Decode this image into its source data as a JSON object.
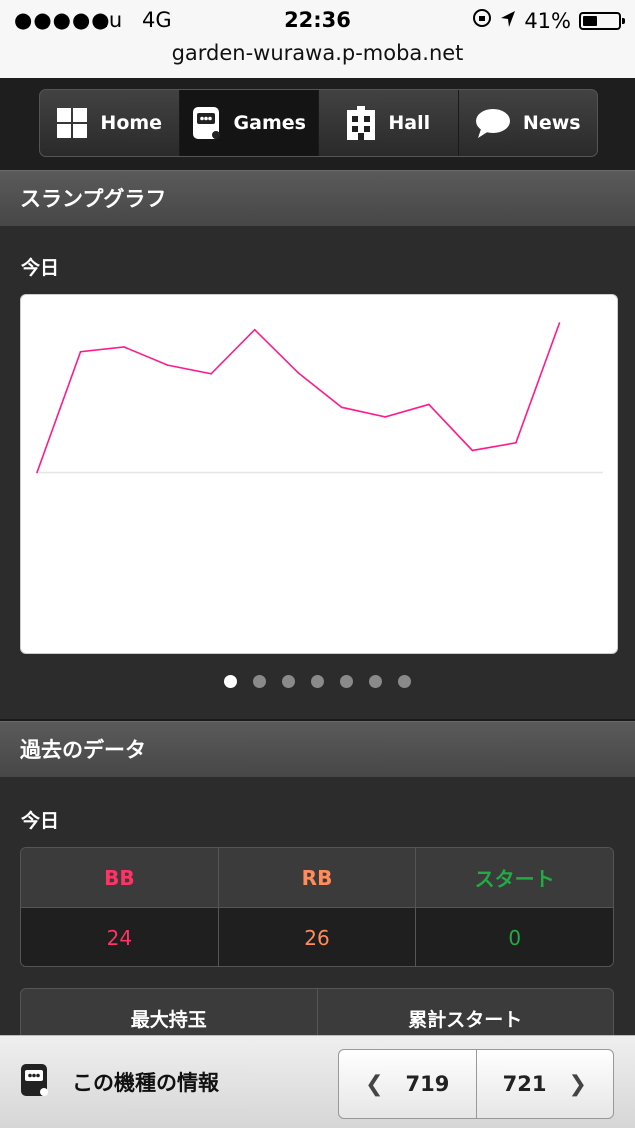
{
  "status_bar": {
    "signal": "●●●●●",
    "carrier": "au",
    "network": "4G",
    "time": "22:36",
    "battery": "41%",
    "battery_level": 0.41
  },
  "url": "garden-wurawa.p-moba.net",
  "nav": {
    "items": [
      {
        "label": "Home",
        "icon": "grid-icon",
        "active": false
      },
      {
        "label": "Games",
        "icon": "slot-machine-icon",
        "active": true
      },
      {
        "label": "Hall",
        "icon": "building-icon",
        "active": false
      },
      {
        "label": "News",
        "icon": "speech-bubble-icon",
        "active": false
      }
    ]
  },
  "slump": {
    "title": "スランプグラフ",
    "period": "今日"
  },
  "chart_data": {
    "type": "line",
    "title": "",
    "xlabel": "",
    "ylabel": "",
    "x": [
      0,
      1,
      2,
      3,
      4,
      5,
      6,
      7,
      8,
      9,
      10,
      11,
      12,
      13
    ],
    "values": [
      0,
      126,
      131,
      112,
      103,
      149,
      104,
      68,
      58,
      71,
      23,
      31,
      156,
      null
    ],
    "ylim": [
      -180,
      180
    ],
    "baseline": 0,
    "line_color": "#ff1a8c",
    "grid": false
  },
  "pager_dots": {
    "count": 7,
    "active": 0
  },
  "past": {
    "title": "過去のデータ",
    "period": "今日",
    "headers": [
      "BB",
      "RB",
      "スタート"
    ],
    "values": [
      "24",
      "26",
      "0"
    ],
    "colors": [
      "#ff3366",
      "#ff8c5a",
      "#22aa44"
    ],
    "headers2": [
      "最大持玉",
      "累計スタート"
    ]
  },
  "bottom": {
    "info_label": "この機種の情報",
    "prev": "719",
    "next": "721"
  }
}
